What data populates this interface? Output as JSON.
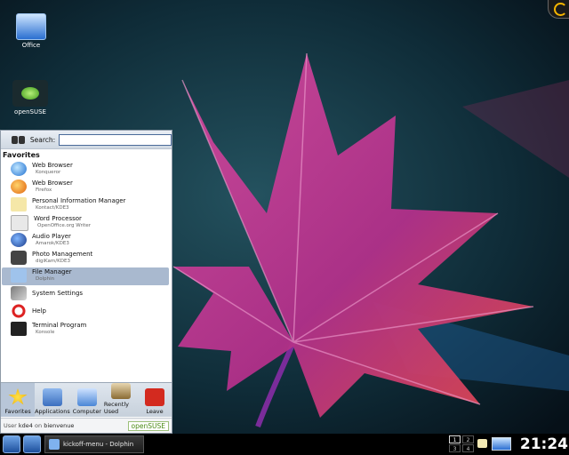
{
  "desktop": {
    "icons": [
      {
        "label": "Office",
        "icon": "office-folder-icon"
      },
      {
        "label": "openSUSE",
        "icon": "opensuse-icon"
      }
    ]
  },
  "kickoff": {
    "search_label": "Search:",
    "search_value": "",
    "favorites_heading": "Favorites",
    "items": [
      {
        "title": "Web Browser",
        "subtitle": "Konqueror",
        "icon": "konqueror-icon"
      },
      {
        "title": "Web Browser",
        "subtitle": "Firefox",
        "icon": "firefox-icon"
      },
      {
        "title": "Personal Information Manager",
        "subtitle": "Kontact/KDE3",
        "icon": "kontact-icon"
      },
      {
        "title": "Word Processor",
        "subtitle": "OpenOffice.org Writer",
        "icon": "writer-icon"
      },
      {
        "title": "Audio Player",
        "subtitle": "Amarok/KDE3",
        "icon": "amarok-icon"
      },
      {
        "title": "Photo Management",
        "subtitle": "digiKam/KDE3",
        "icon": "camera-icon"
      },
      {
        "title": "File Manager",
        "subtitle": "Dolphin",
        "icon": "folder-icon",
        "selected": true
      },
      {
        "title": "System Settings",
        "subtitle": "",
        "icon": "settings-icon"
      },
      {
        "title": "Help",
        "subtitle": "",
        "icon": "help-icon"
      },
      {
        "title": "Terminal Program",
        "subtitle": "Konsole",
        "icon": "terminal-icon"
      }
    ],
    "tabs": [
      {
        "label": "Favorites",
        "icon": "star-icon",
        "active": true
      },
      {
        "label": "Applications",
        "icon": "applications-icon"
      },
      {
        "label": "Computer",
        "icon": "computer-icon"
      },
      {
        "label": "Recently Used",
        "icon": "hourglass-icon"
      },
      {
        "label": "Leave",
        "icon": "leave-icon"
      }
    ],
    "footer_user_prefix": "User",
    "footer_user": "kde4",
    "footer_host_prefix": "on",
    "footer_host": "bienvenue",
    "footer_brand": "openSUSE"
  },
  "taskbar": {
    "task_label": "kickoff-menu - Dolphin",
    "pager": [
      "1",
      "2",
      "3",
      "4"
    ],
    "active_desktop": "1",
    "clock": "21:24"
  },
  "colors": {
    "selection": "#a9b9cf",
    "taskbar": "#000000",
    "menu_border": "#8d99a6"
  }
}
